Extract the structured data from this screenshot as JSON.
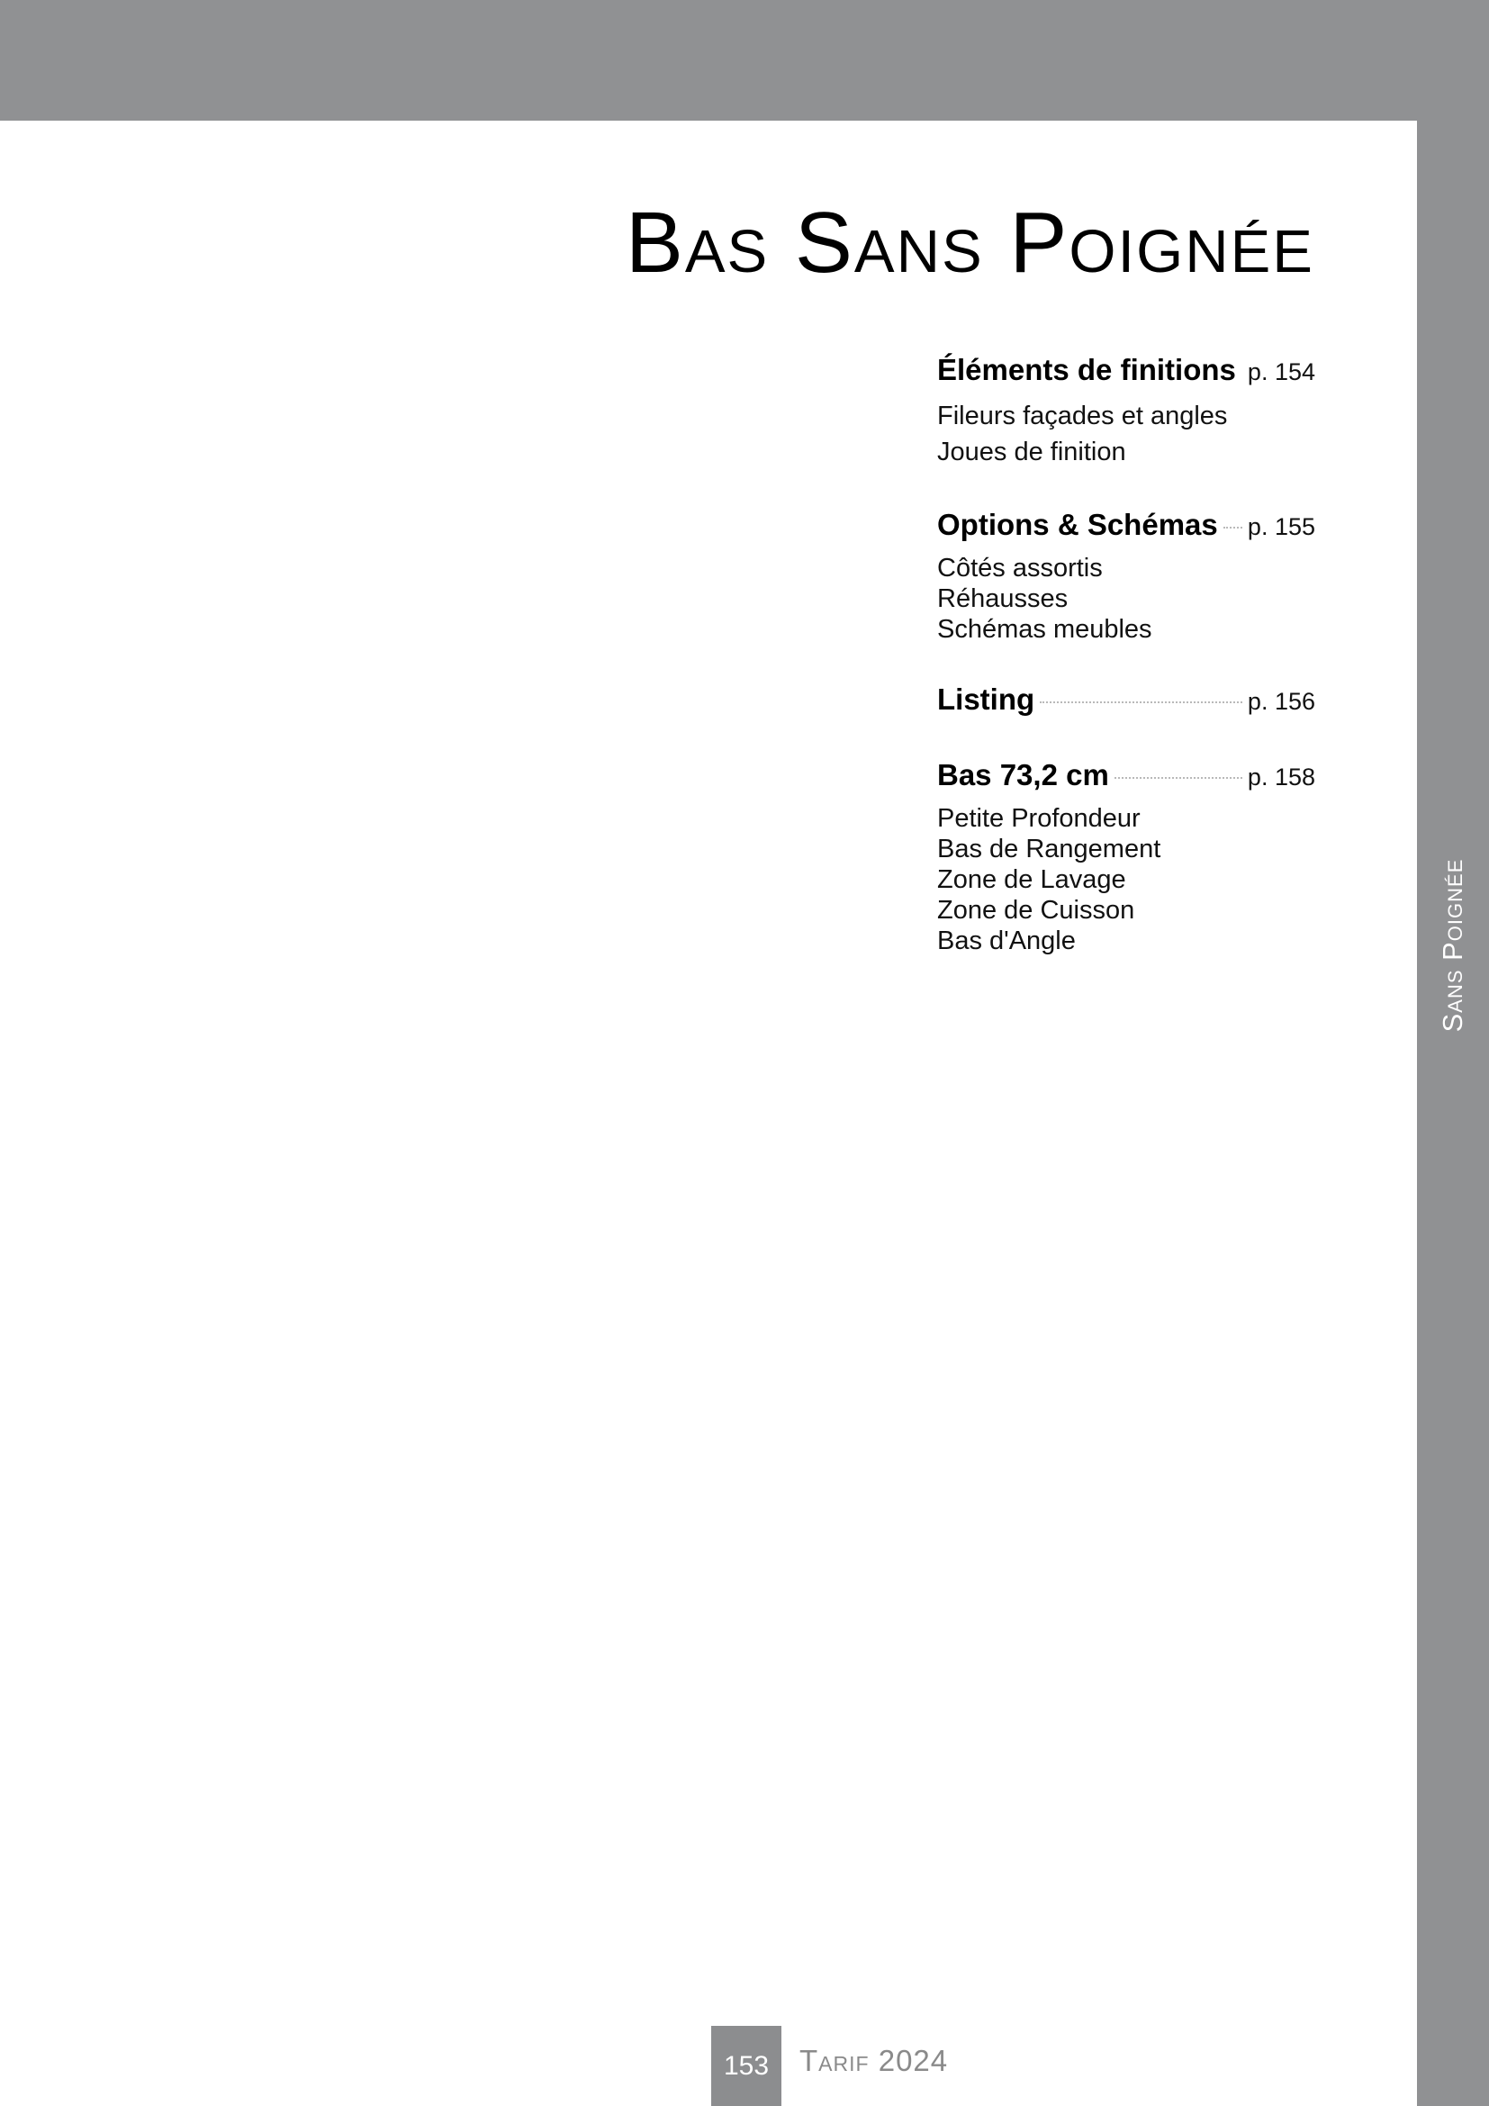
{
  "page": {
    "title": "Bas Sans Poignée",
    "side_label": "Sans Poignée"
  },
  "toc": [
    {
      "heading": "Éléments de finitions",
      "page": "p. 154",
      "items": [
        "Fileurs façades et angles",
        "Joues de finition"
      ]
    },
    {
      "heading": "Options & Schémas",
      "page": "p. 155",
      "items": [
        "Côtés assortis",
        "Réhausses",
        "Schémas meubles"
      ]
    },
    {
      "heading": "Listing",
      "page": "p. 156",
      "items": []
    },
    {
      "heading": "Bas 73,2 cm",
      "page": "p. 158",
      "items": [
        "Petite Profondeur",
        "Bas de Rangement",
        "Zone de Lavage",
        "Zone de Cuisson",
        "Bas d'Angle"
      ]
    }
  ],
  "footer": {
    "page_number": "153",
    "title": "Tarif 2024"
  },
  "colors": {
    "band_gray": "#909193",
    "footer_text": "#8a8a8a"
  }
}
